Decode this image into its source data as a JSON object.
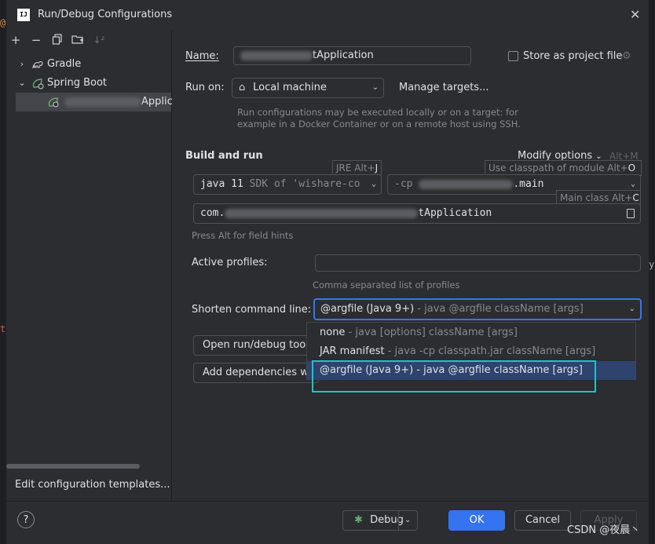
{
  "window": {
    "title": "Run/Debug Configurations",
    "logo": "IJ"
  },
  "left": {
    "toolbar_icons": [
      "add-icon",
      "remove-icon",
      "copy-icon",
      "folder-add-icon",
      "sort-icon"
    ],
    "tree": {
      "gradle": "Gradle",
      "spring_boot": "Spring Boot",
      "app_item_suffix": "Applic"
    },
    "edit_templates": "Edit configuration templates..."
  },
  "form": {
    "name_label": "Name:",
    "name_value_suffix": "tApplication",
    "store_label": "Store as project file",
    "run_on_label": "Run on:",
    "run_on_value": "Local machine",
    "manage_targets": "Manage targets...",
    "run_on_hint_1": "Run configurations may be executed locally or on a target: for",
    "run_on_hint_2": "example in a Docker Container or on a remote host using SSH.",
    "build_run_label": "Build and run",
    "modify_options": "Modify options",
    "modify_shortcut": "Alt+M",
    "jre_tip": "JRE Alt+",
    "jre_key": "J",
    "classpath_tip": "Use classpath of module Alt+",
    "classpath_key": "O",
    "main_tip": "Main class Alt+",
    "main_key": "C",
    "java_value": "java 11",
    "java_sdk": "SDK of 'wishare-co",
    "cp_prefix": "-cp",
    "cp_suffix": ".main",
    "main_prefix": "com.",
    "main_suffix": "tApplication",
    "field_hints": "Press Alt for field hints",
    "active_profiles_label": "Active profiles:",
    "active_profiles_value": "",
    "active_profiles_hint": "Comma separated list of profiles",
    "shorten_label": "Shorten command line:",
    "shorten_value": "@argfile (Java 9+)",
    "shorten_value_dim": " - java @argfile className [args]",
    "open_tool_button": "Open run/debug tool w",
    "add_deps_button": "Add dependencies wit"
  },
  "dropdown": {
    "options": [
      {
        "name": "none",
        "desc": " - java [options] className [args]"
      },
      {
        "name": "JAR manifest",
        "desc": " - java -cp classpath.jar className [args]"
      },
      {
        "name": "@argfile (Java 9+)",
        "desc": " - java @argfile className [args]"
      }
    ]
  },
  "buttons": {
    "help": "?",
    "debug": "Debug",
    "ok": "OK",
    "cancel": "Cancel",
    "apply": "Apply"
  },
  "watermark": "CSDN @夜晨丶",
  "colors": {
    "accent": "#3574f0",
    "link": "#548af7",
    "highlight_box": "#19c6c9",
    "spring_green": "#6aab73"
  }
}
